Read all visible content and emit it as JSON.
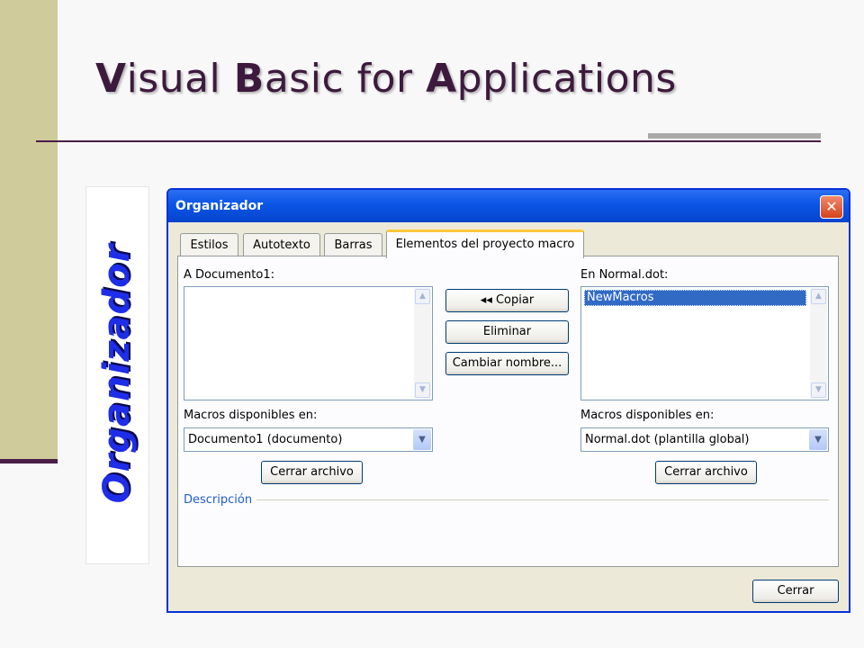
{
  "slide": {
    "title_parts": [
      {
        "initial": "V",
        "rest": "isual "
      },
      {
        "initial": "B",
        "rest": "asic for "
      },
      {
        "initial": "A",
        "rest": "pplications"
      }
    ],
    "side_label": "Organizador"
  },
  "dialog": {
    "title": "Organizador",
    "close_icon": "close-icon",
    "tabs": [
      {
        "label": "Estilos",
        "active": false
      },
      {
        "label": "Autotexto",
        "active": false
      },
      {
        "label": "Barras",
        "active": false
      },
      {
        "label": "Elementos del proyecto macro",
        "active": true
      }
    ],
    "left_pane": {
      "list_label": "A Documento1:",
      "items": [],
      "available_label": "Macros disponibles en:",
      "available_value": "Documento1 (documento)",
      "close_file_button": "Cerrar archivo"
    },
    "middle_buttons": {
      "copy": "◂◂ Copiar",
      "delete": "Eliminar",
      "rename": "Cambiar nombre..."
    },
    "right_pane": {
      "list_label": "En Normal.dot:",
      "items": [
        "NewMacros"
      ],
      "available_label": "Macros disponibles en:",
      "available_value": "Normal.dot (plantilla global)",
      "close_file_button": "Cerrar archivo"
    },
    "description_label": "Descripción",
    "close_button": "Cerrar"
  },
  "colors": {
    "title_color": "#3d1a3d",
    "side_label_color": "#1e2de8",
    "titlebar_blue": "#0a55e6",
    "selection_blue": "#316ac5"
  }
}
